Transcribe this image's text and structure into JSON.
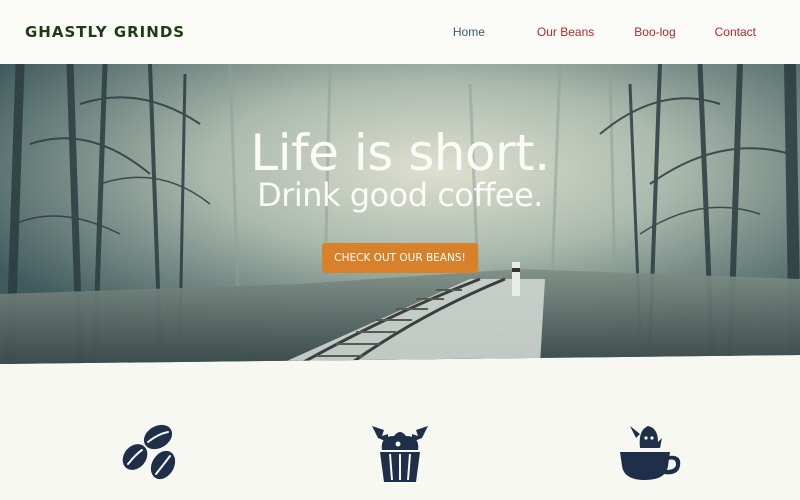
{
  "header": {
    "logo": "GHASTLY GRINDS",
    "nav": [
      "Home",
      "Our Beans",
      "Boo-log",
      "Contact"
    ]
  },
  "hero": {
    "headline": "Life is short.",
    "subheadline": "Drink good coffee.",
    "cta_label": "CHECK OUT OUR BEANS!"
  },
  "features": [
    {
      "icon": "coffee-beans-icon"
    },
    {
      "icon": "bat-cupcake-icon"
    },
    {
      "icon": "ghost-coffee-cup-icon"
    }
  ],
  "colors": {
    "accent": "#d9802a",
    "nav_link": "#b02a2a",
    "nav_active": "#3a5a6a",
    "logo": "#1f3a18",
    "icon": "#1f2f4a",
    "background": "#f8f8f3"
  }
}
